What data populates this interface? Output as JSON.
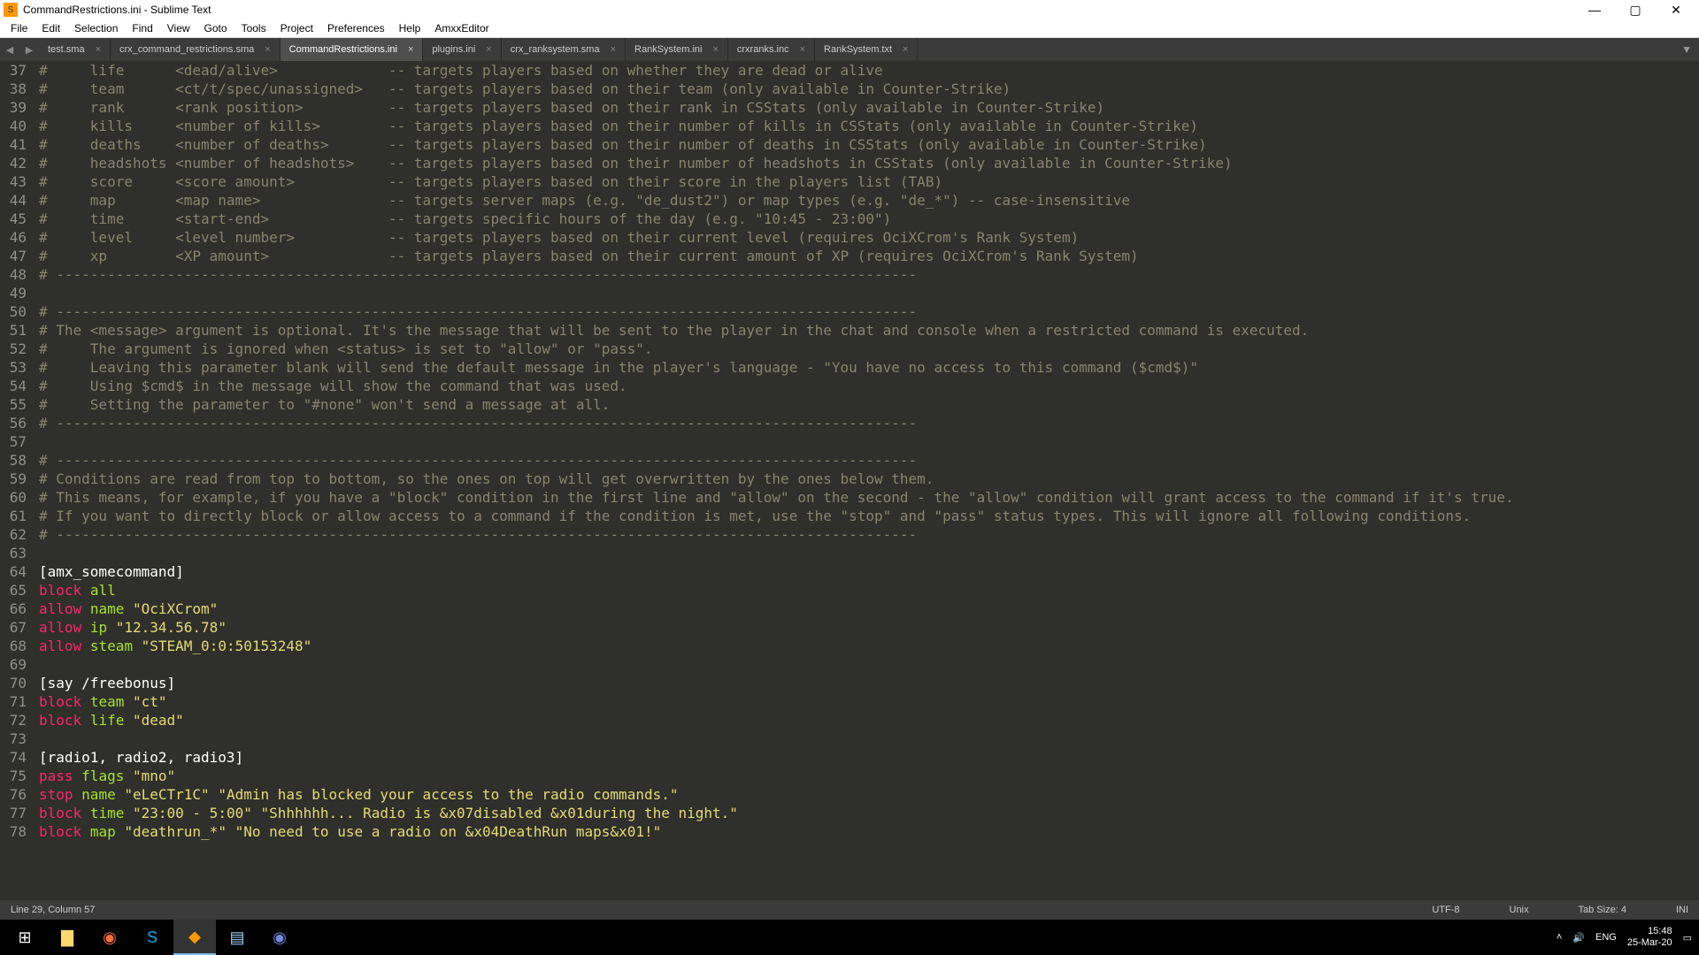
{
  "window": {
    "title": "CommandRestrictions.ini - Sublime Text"
  },
  "menu": [
    "File",
    "Edit",
    "Selection",
    "Find",
    "View",
    "Goto",
    "Tools",
    "Project",
    "Preferences",
    "Help",
    "AmxxEditor"
  ],
  "tabs": [
    {
      "label": "test.sma",
      "active": false
    },
    {
      "label": "crx_command_restrictions.sma",
      "active": false
    },
    {
      "label": "CommandRestrictions.ini",
      "active": true
    },
    {
      "label": "plugins.ini",
      "active": false
    },
    {
      "label": "crx_ranksystem.sma",
      "active": false
    },
    {
      "label": "RankSystem.ini",
      "active": false
    },
    {
      "label": "crxranks.inc",
      "active": false
    },
    {
      "label": "RankSystem.txt",
      "active": false
    }
  ],
  "editor": {
    "first_line": 37,
    "lines": [
      {
        "type": "comment",
        "text": "#     life      <dead/alive>             -- targets players based on whether they are dead or alive"
      },
      {
        "type": "comment",
        "text": "#     team      <ct/t/spec/unassigned>   -- targets players based on their team (only available in Counter-Strike)"
      },
      {
        "type": "comment",
        "text": "#     rank      <rank position>          -- targets players based on their rank in CSStats (only available in Counter-Strike)"
      },
      {
        "type": "comment",
        "text": "#     kills     <number of kills>        -- targets players based on their number of kills in CSStats (only available in Counter-Strike)"
      },
      {
        "type": "comment",
        "text": "#     deaths    <number of deaths>       -- targets players based on their number of deaths in CSStats (only available in Counter-Strike)"
      },
      {
        "type": "comment",
        "text": "#     headshots <number of headshots>    -- targets players based on their number of headshots in CSStats (only available in Counter-Strike)"
      },
      {
        "type": "comment",
        "text": "#     score     <score amount>           -- targets players based on their score in the players list (TAB)"
      },
      {
        "type": "comment",
        "text": "#     map       <map name>               -- targets server maps (e.g. \"de_dust2\") or map types (e.g. \"de_*\") -- case-insensitive"
      },
      {
        "type": "comment",
        "text": "#     time      <start-end>              -- targets specific hours of the day (e.g. \"10:45 - 23:00\")"
      },
      {
        "type": "comment",
        "text": "#     level     <level number>           -- targets players based on their current level (requires OciXCrom's Rank System)"
      },
      {
        "type": "comment",
        "text": "#     xp        <XP amount>              -- targets players based on their current amount of XP (requires OciXCrom's Rank System)"
      },
      {
        "type": "comment",
        "text": "# -----------------------------------------------------------------------------------------------------"
      },
      {
        "type": "blank",
        "text": ""
      },
      {
        "type": "comment",
        "text": "# -----------------------------------------------------------------------------------------------------"
      },
      {
        "type": "comment",
        "text": "# The <message> argument is optional. It's the message that will be sent to the player in the chat and console when a restricted command is executed."
      },
      {
        "type": "comment",
        "text": "#     The argument is ignored when <status> is set to \"allow\" or \"pass\"."
      },
      {
        "type": "comment",
        "text": "#     Leaving this parameter blank will send the default message in the player's language - \"You have no access to this command ($cmd$)\""
      },
      {
        "type": "comment",
        "text": "#     Using $cmd$ in the message will show the command that was used."
      },
      {
        "type": "comment",
        "text": "#     Setting the parameter to \"#none\" won't send a message at all."
      },
      {
        "type": "comment",
        "text": "# -----------------------------------------------------------------------------------------------------"
      },
      {
        "type": "blank",
        "text": ""
      },
      {
        "type": "comment",
        "text": "# -----------------------------------------------------------------------------------------------------"
      },
      {
        "type": "comment",
        "text": "# Conditions are read from top to bottom, so the ones on top will get overwritten by the ones below them."
      },
      {
        "type": "comment",
        "text": "# This means, for example, if you have a \"block\" condition in the first line and \"allow\" on the second - the \"allow\" condition will grant access to the command if it's true."
      },
      {
        "type": "comment",
        "text": "# If you want to directly block or allow access to a command if the condition is met, use the \"stop\" and \"pass\" status types. This will ignore all following conditions."
      },
      {
        "type": "comment",
        "text": "# -----------------------------------------------------------------------------------------------------"
      },
      {
        "type": "blank",
        "text": ""
      },
      {
        "type": "section",
        "text": "[amx_somecommand]"
      },
      {
        "type": "cmd",
        "key": "block",
        "arg": "all",
        "strs": []
      },
      {
        "type": "cmd",
        "key": "allow",
        "arg": "name",
        "strs": [
          "\"OciXCrom\""
        ]
      },
      {
        "type": "cmd",
        "key": "allow",
        "arg": "ip",
        "strs": [
          "\"12.34.56.78\""
        ]
      },
      {
        "type": "cmd",
        "key": "allow",
        "arg": "steam",
        "strs": [
          "\"STEAM_0:0:50153248\""
        ]
      },
      {
        "type": "blank",
        "text": ""
      },
      {
        "type": "section",
        "text": "[say /freebonus]"
      },
      {
        "type": "cmd",
        "key": "block",
        "arg": "team",
        "strs": [
          "\"ct\""
        ]
      },
      {
        "type": "cmd",
        "key": "block",
        "arg": "life",
        "strs": [
          "\"dead\""
        ]
      },
      {
        "type": "blank",
        "text": ""
      },
      {
        "type": "section",
        "text": "[radio1, radio2, radio3]"
      },
      {
        "type": "cmd",
        "key": "pass",
        "arg": "flags",
        "strs": [
          "\"mno\""
        ]
      },
      {
        "type": "cmd",
        "key": "stop",
        "arg": "name",
        "strs": [
          "\"eLeCTr1C\"",
          "\"Admin has blocked your access to the radio commands.\""
        ]
      },
      {
        "type": "cmd",
        "key": "block",
        "arg": "time",
        "strs": [
          "\"23:00 - 5:00\"",
          "\"Shhhhhh... Radio is &x07disabled &x01during the night.\""
        ]
      },
      {
        "type": "cmd",
        "key": "block",
        "arg": "map",
        "strs": [
          "\"deathrun_*\"",
          "\"No need to use a radio on &x04DeathRun maps&x01!\""
        ]
      }
    ]
  },
  "status": {
    "left": "Line 29, Column 57",
    "encoding": "UTF-8",
    "line_endings": "Unix",
    "tab_size": "Tab Size: 4",
    "syntax": "INI"
  },
  "taskbar": {
    "icons": [
      "start",
      "explorer",
      "firefox",
      "skype",
      "sublime",
      "notepad",
      "discord"
    ],
    "lang": "ENG",
    "time": "15:48",
    "date": "25-Mar-20"
  }
}
